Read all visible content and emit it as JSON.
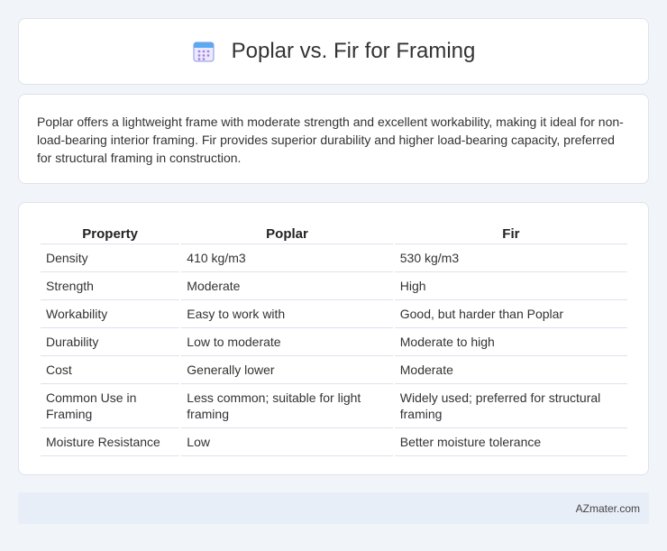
{
  "header": {
    "title": "Poplar vs. Fir for Framing",
    "icon": "calendar-icon"
  },
  "summary": {
    "text": "Poplar offers a lightweight frame with moderate strength and excellent workability, making it ideal for non-load-bearing interior framing. Fir provides superior durability and higher load-bearing capacity, preferred for structural framing in construction."
  },
  "table": {
    "headers": [
      "Property",
      "Poplar",
      "Fir"
    ],
    "rows": [
      [
        "Density",
        "410 kg/m3",
        "530 kg/m3"
      ],
      [
        "Strength",
        "Moderate",
        "High"
      ],
      [
        "Workability",
        "Easy to work with",
        "Good, but harder than Poplar"
      ],
      [
        "Durability",
        "Low to moderate",
        "Moderate to high"
      ],
      [
        "Cost",
        "Generally lower",
        "Moderate"
      ],
      [
        "Common Use in Framing",
        "Less common; suitable for light framing",
        "Widely used; preferred for structural framing"
      ],
      [
        "Moisture Resistance",
        "Low",
        "Better moisture tolerance"
      ]
    ]
  },
  "footer": {
    "text": "AZmater.com"
  },
  "colors": {
    "background": "#f1f4f9",
    "card": "#ffffff",
    "border": "#dde3ec",
    "footer_bg": "#e8eef8",
    "icon_accent": "#7b7fe0"
  }
}
